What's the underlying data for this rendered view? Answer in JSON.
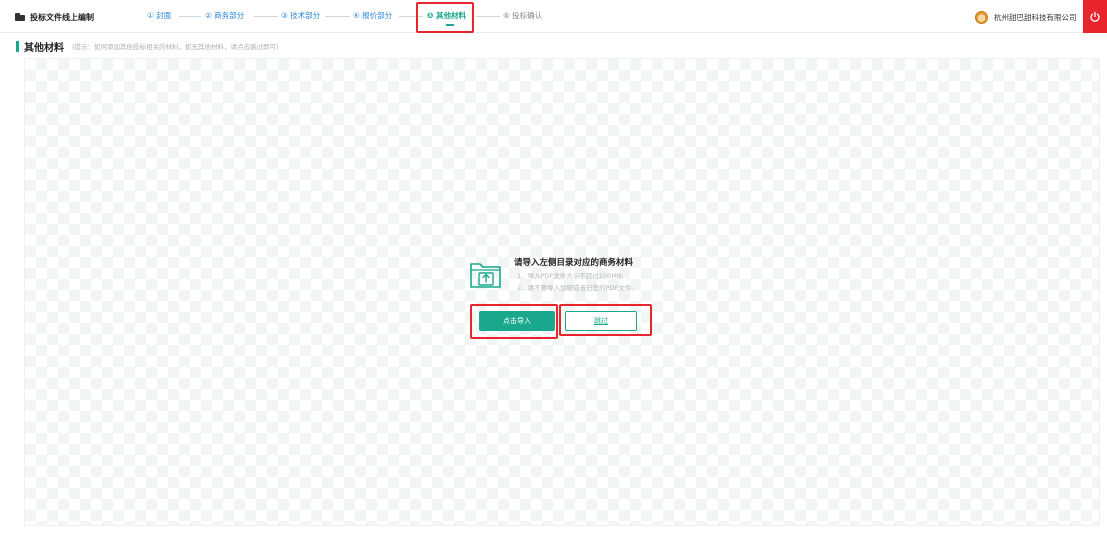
{
  "header": {
    "title": "投标文件线上编制",
    "steps": [
      {
        "label": "① 封面"
      },
      {
        "label": "② 商务部分"
      },
      {
        "label": "③ 技术部分"
      },
      {
        "label": "④ 报价部分"
      },
      {
        "label": "❺ 其他材料"
      },
      {
        "label": "⑥ 投标确认"
      }
    ],
    "company": "杭州甜巴甜科技有限公司"
  },
  "section": {
    "title": "其他材料",
    "hint": "(提示：如何添加其他投标相关的材料，如无其他材料，请点击跳过即可)"
  },
  "import_panel": {
    "heading": "请导入左侧目录对应的商务材料",
    "notes": [
      "1、导入PDF文件大小不超过100MB;",
      "2、请不要导入加密或者已签的PDF文件;"
    ],
    "import_button": "点击导入",
    "skip_button": "跳过"
  },
  "colors": {
    "accent": "#19a88b",
    "link": "#2b86d9",
    "highlight": "#e8242d"
  },
  "icons": {
    "brand": "folder-icon",
    "power": "power-icon",
    "import": "folder-upload-icon"
  }
}
